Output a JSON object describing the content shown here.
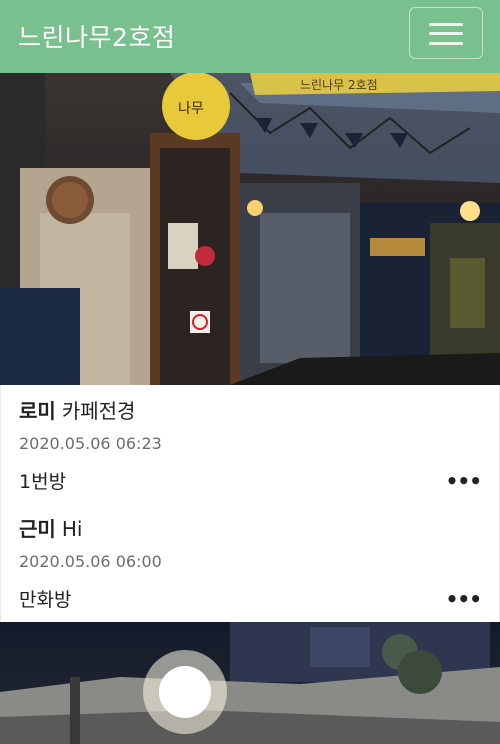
{
  "navbar": {
    "brand": "느린나무2호점",
    "menu_icon": "hamburger-icon",
    "color": "#79c08f"
  },
  "photos": [
    {
      "description_icon": "cafe-entrance-photo",
      "sign_text": "느린나무 2호점"
    },
    {
      "description_icon": "cafe-night-photo"
    }
  ],
  "posts": [
    {
      "author": "로미",
      "title": "카페전경",
      "date": "2020.05.06 06:23",
      "room": "1번방",
      "more": "•••"
    },
    {
      "author": "근미",
      "title": "Hi",
      "date": "2020.05.06 06:00",
      "room": "만화방",
      "more": "•••"
    }
  ]
}
